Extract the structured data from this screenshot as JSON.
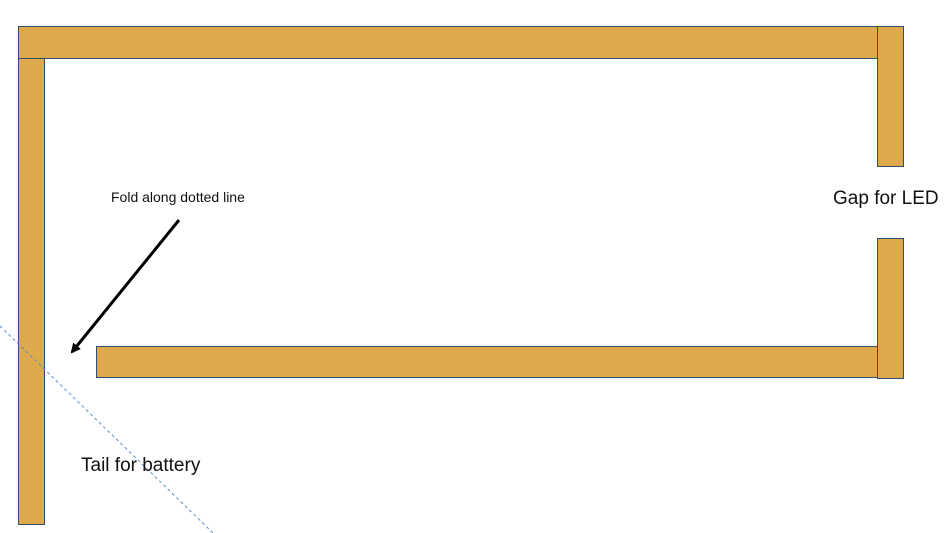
{
  "colors": {
    "strip_fill": "#DDA94A",
    "strip_border": "#2F4F6F",
    "arrow": "#000000",
    "fold_line": "#5B8CC8",
    "text": "#111111",
    "background": "#FFFFFF"
  },
  "labels": {
    "fold_instruction": "Fold along dotted line",
    "gap": "Gap for LED",
    "tail": "Tail for battery"
  }
}
